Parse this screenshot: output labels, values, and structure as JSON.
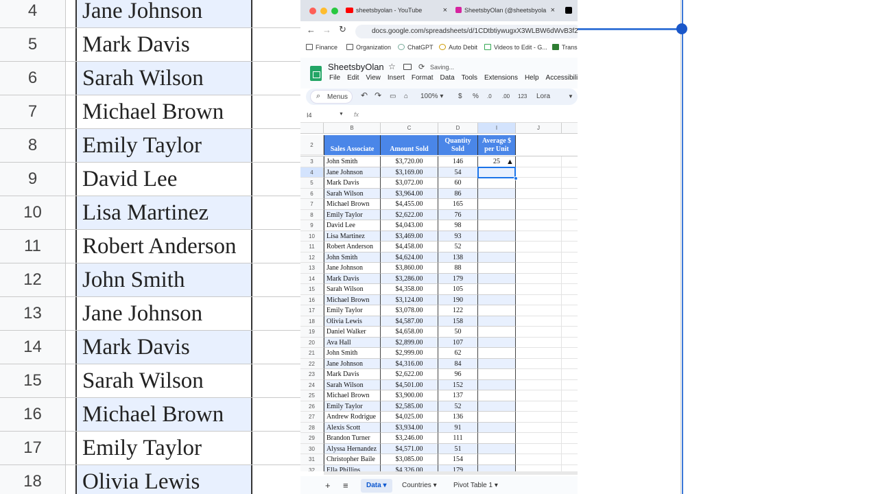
{
  "background": {
    "rows": [
      {
        "num": "4",
        "name": "Jane Johnson"
      },
      {
        "num": "5",
        "name": "Mark Davis"
      },
      {
        "num": "6",
        "name": "Sarah Wilson"
      },
      {
        "num": "7",
        "name": "Michael Brown"
      },
      {
        "num": "8",
        "name": "Emily Taylor"
      },
      {
        "num": "9",
        "name": "David Lee"
      },
      {
        "num": "10",
        "name": "Lisa Martinez"
      },
      {
        "num": "11",
        "name": "Robert Anderson"
      },
      {
        "num": "12",
        "name": "John Smith"
      },
      {
        "num": "13",
        "name": "Jane Johnson"
      },
      {
        "num": "14",
        "name": "Mark Davis"
      },
      {
        "num": "15",
        "name": "Sarah Wilson"
      },
      {
        "num": "16",
        "name": "Michael Brown"
      },
      {
        "num": "17",
        "name": "Emily Taylor"
      },
      {
        "num": "18",
        "name": "Olivia Lewis"
      }
    ]
  },
  "browser": {
    "tabs": [
      {
        "label": "sheetsbyolan - YouTube",
        "icon": "youtube-icon"
      },
      {
        "label": "SheetsbyOlan (@sheetsbyola",
        "icon": "instagram-icon"
      }
    ],
    "url": "docs.google.com/spreadsheets/d/1CDtbtiywugxX3WLBW6dWvB3f2",
    "bookmarks": [
      "Finance",
      "Organization",
      "ChatGPT",
      "Auto Debit",
      "Videos to Edit - G...",
      "Transi"
    ]
  },
  "app": {
    "title": "SheetsbyOlan",
    "status": "Saving...",
    "menu": [
      "File",
      "Edit",
      "View",
      "Insert",
      "Format",
      "Data",
      "Tools",
      "Extensions",
      "Help",
      "Accessibili"
    ]
  },
  "toolbar": {
    "search": "Menus",
    "zoom": "100%",
    "dollar": "$",
    "percent": "%",
    "dec_minus": ".0",
    "dec_plus": ".00",
    "num_fmt": "123",
    "font": "Lora"
  },
  "formula_bar": {
    "cell_ref": "I4",
    "fx": "fx",
    "value": ""
  },
  "columns": [
    "B",
    "C",
    "D",
    "I",
    "J"
  ],
  "header": {
    "b": "Sales Associate",
    "c": "Amount Sold",
    "d": "Quantity Sold",
    "i": "Average $ per Unit"
  },
  "rows": [
    {
      "n": "3",
      "b": "John Smith",
      "c": "$3,720.00",
      "d": "146",
      "i": "25"
    },
    {
      "n": "4",
      "b": "Jane Johnson",
      "c": "$3,169.00",
      "d": "54",
      "i": ""
    },
    {
      "n": "5",
      "b": "Mark Davis",
      "c": "$3,072.00",
      "d": "60",
      "i": ""
    },
    {
      "n": "6",
      "b": "Sarah Wilson",
      "c": "$3,964.00",
      "d": "86",
      "i": ""
    },
    {
      "n": "7",
      "b": "Michael Brown",
      "c": "$4,455.00",
      "d": "165",
      "i": ""
    },
    {
      "n": "8",
      "b": "Emily Taylor",
      "c": "$2,622.00",
      "d": "76",
      "i": ""
    },
    {
      "n": "9",
      "b": "David Lee",
      "c": "$4,043.00",
      "d": "98",
      "i": ""
    },
    {
      "n": "10",
      "b": "Lisa Martinez",
      "c": "$3,469.00",
      "d": "93",
      "i": ""
    },
    {
      "n": "11",
      "b": "Robert Anderson",
      "c": "$4,458.00",
      "d": "52",
      "i": ""
    },
    {
      "n": "12",
      "b": "John Smith",
      "c": "$4,624.00",
      "d": "138",
      "i": ""
    },
    {
      "n": "13",
      "b": "Jane Johnson",
      "c": "$3,860.00",
      "d": "88",
      "i": ""
    },
    {
      "n": "14",
      "b": "Mark Davis",
      "c": "$3,286.00",
      "d": "179",
      "i": ""
    },
    {
      "n": "15",
      "b": "Sarah Wilson",
      "c": "$4,358.00",
      "d": "105",
      "i": ""
    },
    {
      "n": "16",
      "b": "Michael Brown",
      "c": "$3,124.00",
      "d": "190",
      "i": ""
    },
    {
      "n": "17",
      "b": "Emily Taylor",
      "c": "$3,078.00",
      "d": "122",
      "i": ""
    },
    {
      "n": "18",
      "b": "Olivia Lewis",
      "c": "$4,587.00",
      "d": "158",
      "i": ""
    },
    {
      "n": "19",
      "b": "Daniel Walker",
      "c": "$4,658.00",
      "d": "50",
      "i": ""
    },
    {
      "n": "20",
      "b": "Ava Hall",
      "c": "$2,899.00",
      "d": "107",
      "i": ""
    },
    {
      "n": "21",
      "b": "John Smith",
      "c": "$2,999.00",
      "d": "62",
      "i": ""
    },
    {
      "n": "22",
      "b": "Jane Johnson",
      "c": "$4,316.00",
      "d": "84",
      "i": ""
    },
    {
      "n": "23",
      "b": "Mark Davis",
      "c": "$2,622.00",
      "d": "96",
      "i": ""
    },
    {
      "n": "24",
      "b": "Sarah Wilson",
      "c": "$4,501.00",
      "d": "152",
      "i": ""
    },
    {
      "n": "25",
      "b": "Michael Brown",
      "c": "$3,900.00",
      "d": "137",
      "i": ""
    },
    {
      "n": "26",
      "b": "Emily Taylor",
      "c": "$2,585.00",
      "d": "52",
      "i": ""
    },
    {
      "n": "27",
      "b": "Andrew Rodrigue",
      "c": "$4,025.00",
      "d": "136",
      "i": ""
    },
    {
      "n": "28",
      "b": "Alexis Scott",
      "c": "$3,934.00",
      "d": "91",
      "i": ""
    },
    {
      "n": "29",
      "b": "Brandon Turner",
      "c": "$3,246.00",
      "d": "111",
      "i": ""
    },
    {
      "n": "30",
      "b": "Alyssa Hernandez",
      "c": "$4,571.00",
      "d": "51",
      "i": ""
    },
    {
      "n": "31",
      "b": "Christopher Baile",
      "c": "$3,085.00",
      "d": "154",
      "i": ""
    },
    {
      "n": "32",
      "b": "Ella Phillips",
      "c": "$4,326.00",
      "d": "179",
      "i": ""
    }
  ],
  "sheets": [
    {
      "label": "Data",
      "active": true
    },
    {
      "label": "Countries",
      "active": false
    },
    {
      "label": "Pivot Table 1",
      "active": false
    }
  ]
}
